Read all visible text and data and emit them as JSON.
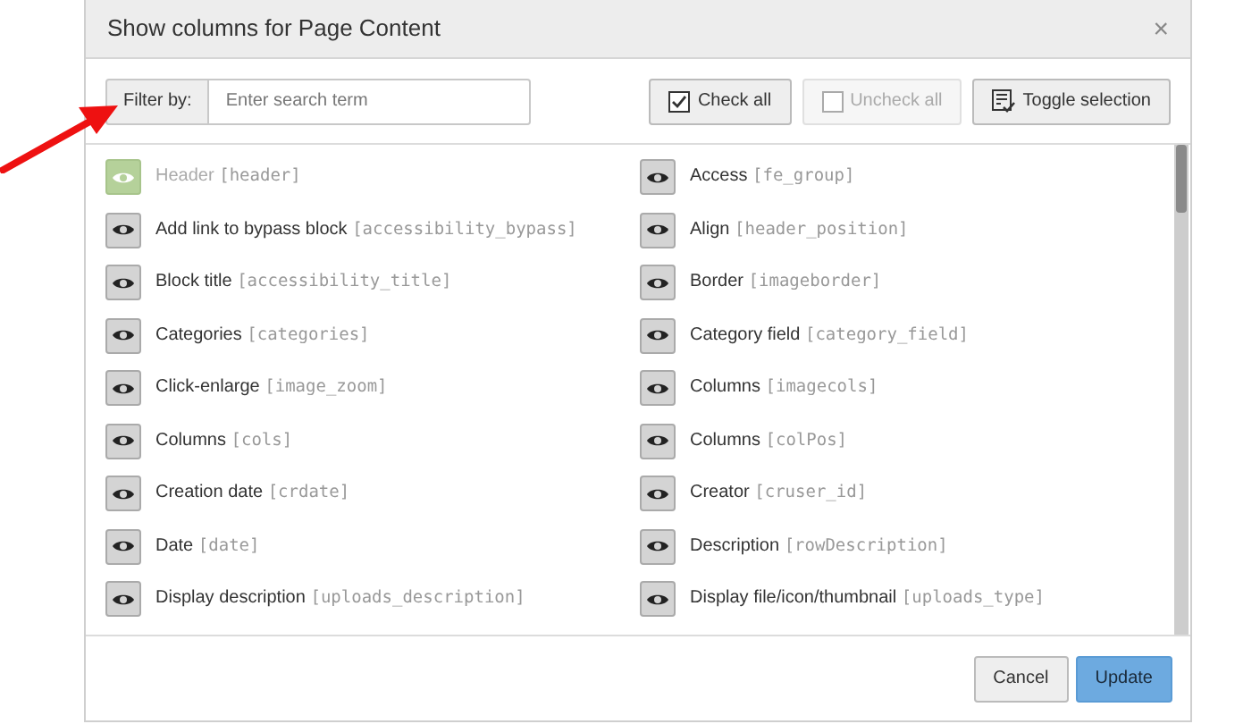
{
  "dialog": {
    "title": "Show columns for Page Content",
    "close": "×"
  },
  "filter": {
    "label": "Filter by:",
    "placeholder": "Enter search term"
  },
  "actions": [
    {
      "kind": "check",
      "label": "Check all",
      "disabled": false
    },
    {
      "kind": "uncheck",
      "label": "Uncheck all",
      "disabled": true
    },
    {
      "kind": "toggle",
      "label": "Toggle selection",
      "disabled": false
    }
  ],
  "columns": [
    {
      "label": "Header",
      "field": "[header]",
      "locked": true
    },
    {
      "label": "Access",
      "field": "[fe_group]",
      "locked": false
    },
    {
      "label": "Add link to bypass block",
      "field": "[accessibility_bypass]",
      "locked": false
    },
    {
      "label": "Align",
      "field": "[header_position]",
      "locked": false
    },
    {
      "label": "Block title",
      "field": "[accessibility_title]",
      "locked": false
    },
    {
      "label": "Border",
      "field": "[imageborder]",
      "locked": false
    },
    {
      "label": "Categories",
      "field": "[categories]",
      "locked": false
    },
    {
      "label": "Category field",
      "field": "[category_field]",
      "locked": false
    },
    {
      "label": "Click-enlarge",
      "field": "[image_zoom]",
      "locked": false
    },
    {
      "label": "Columns",
      "field": "[imagecols]",
      "locked": false
    },
    {
      "label": "Columns",
      "field": "[cols]",
      "locked": false
    },
    {
      "label": "Columns",
      "field": "[colPos]",
      "locked": false
    },
    {
      "label": "Creation date",
      "field": "[crdate]",
      "locked": false
    },
    {
      "label": "Creator",
      "field": "[cruser_id]",
      "locked": false
    },
    {
      "label": "Date",
      "field": "[date]",
      "locked": false
    },
    {
      "label": "Description",
      "field": "[rowDescription]",
      "locked": false
    },
    {
      "label": "Display description",
      "field": "[uploads_description]",
      "locked": false
    },
    {
      "label": "Display file/icon/thumbnail",
      "field": "[uploads_type]",
      "locked": false
    }
  ],
  "footer": {
    "buttons": [
      {
        "kind": "default",
        "label": "Cancel"
      },
      {
        "kind": "primary",
        "label": "Update"
      }
    ]
  }
}
